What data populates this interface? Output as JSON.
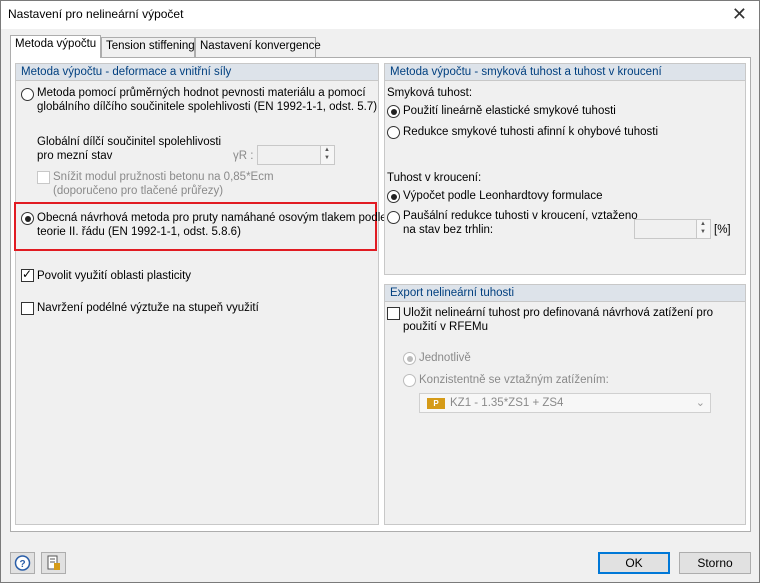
{
  "window": {
    "title": "Nastavení pro nelineární výpočet"
  },
  "tabs": [
    {
      "label": "Metoda výpočtu"
    },
    {
      "label": "Tension stiffening"
    },
    {
      "label": "Nastavení konvergence"
    }
  ],
  "left": {
    "header": "Metoda výpočtu - deformace a vnitřní síly",
    "radio1_line1": "Metoda pomocí průměrných hodnot pevnosti materiálu a pomocí",
    "radio1_line2": "globálního dílčího součinitele spolehlivosti (EN 1992-1-1, odst. 5.7)",
    "factor_line1": "Globální dílčí součinitel spolehlivosti",
    "factor_line2": "pro mezní stav",
    "gamma_label": "γR :",
    "reduce_line1": "Snížit modul pružnosti betonu na 0,85*Ecm",
    "reduce_line2": "(doporučeno pro tlačené průřezy)",
    "radio2_line1": "Obecná návrhová metoda pro pruty namáhané osovým tlakem podle",
    "radio2_line2": "teorie II. řádu (EN 1992-1-1, odst. 5.8.6)",
    "plasticity": "Povolit využití oblasti plasticity",
    "design_reinf": "Navržení podélné výztuže na stupeň využití"
  },
  "right": {
    "header": "Metoda výpočtu - smyková tuhost a tuhost v kroucení",
    "shear_title": "Smyková tuhost:",
    "shear_opt1": "Použití lineárně elastické smykové tuhosti",
    "shear_opt2": "Redukce smykové tuhosti afinní k ohybové tuhosti",
    "torsion_title": "Tuhost v kroucení:",
    "torsion_opt1": "Výpočet podle Leonhardtovy formulace",
    "torsion_opt2_line1": "Paušální redukce tuhosti v kroucení, vztaženo",
    "torsion_opt2_line2": "na stav bez trhlin:",
    "unit": "[%]"
  },
  "export": {
    "header": "Export nelineární tuhosti",
    "save_line1": "Uložit nelineární tuhost pro definovaná návrhová zatížení pro",
    "save_line2": "použití v RFEMu",
    "individually": "Jednotlivě",
    "consistent": "Konzistentně se vztažným zatížením:",
    "combo_badge": "P",
    "combo_value": "KZ1 - 1.35*ZS1 + ZS4"
  },
  "footer": {
    "ok": "OK",
    "cancel": "Storno"
  }
}
